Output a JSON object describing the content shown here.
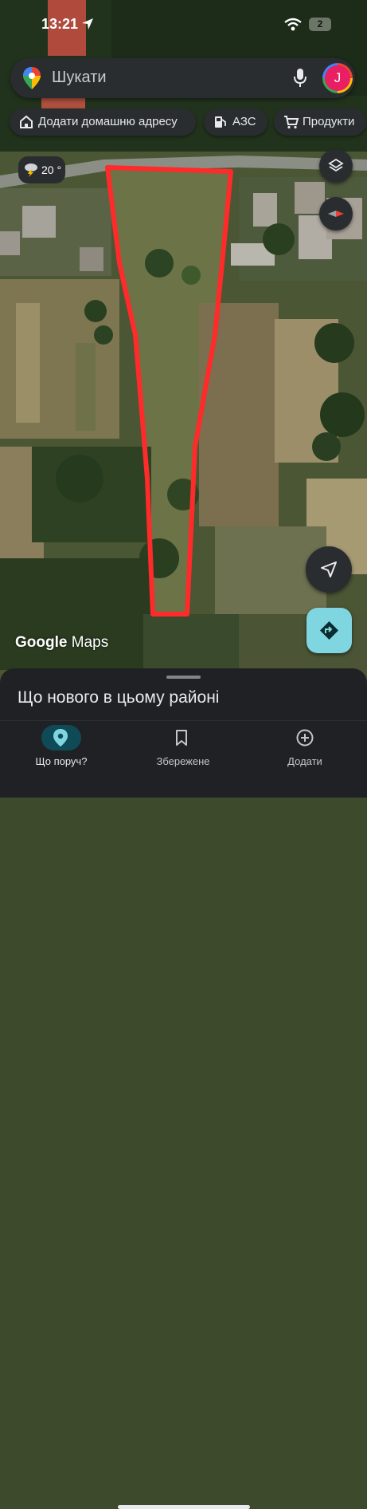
{
  "status_bar": {
    "time": "13:21",
    "battery": "2"
  },
  "search": {
    "placeholder": "Шукати",
    "avatar_letter": "J"
  },
  "chips": [
    {
      "label": "Додати домашню адресу",
      "icon": "home-icon"
    },
    {
      "label": "АЗС",
      "icon": "gas-station-icon"
    },
    {
      "label": "Продукти",
      "icon": "cart-icon"
    }
  ],
  "weather": {
    "temperature": "20 °",
    "icon": "thunderstorm-icon"
  },
  "map": {
    "attribution_brand": "Google",
    "attribution_product": "Maps",
    "outline_color": "#ff2a2a"
  },
  "sheet": {
    "title": "Що нового в цьому районі"
  },
  "bottom_nav": [
    {
      "label": "Що поруч?",
      "icon": "explore-pin-icon",
      "active": true
    },
    {
      "label": "Збережене",
      "icon": "bookmark-icon",
      "active": false
    },
    {
      "label": "Додати",
      "icon": "add-circle-icon",
      "active": false
    }
  ],
  "colors": {
    "accent": "#7fd6e0",
    "surface": "#2a2d30",
    "active_nav": "#0f4a57"
  }
}
